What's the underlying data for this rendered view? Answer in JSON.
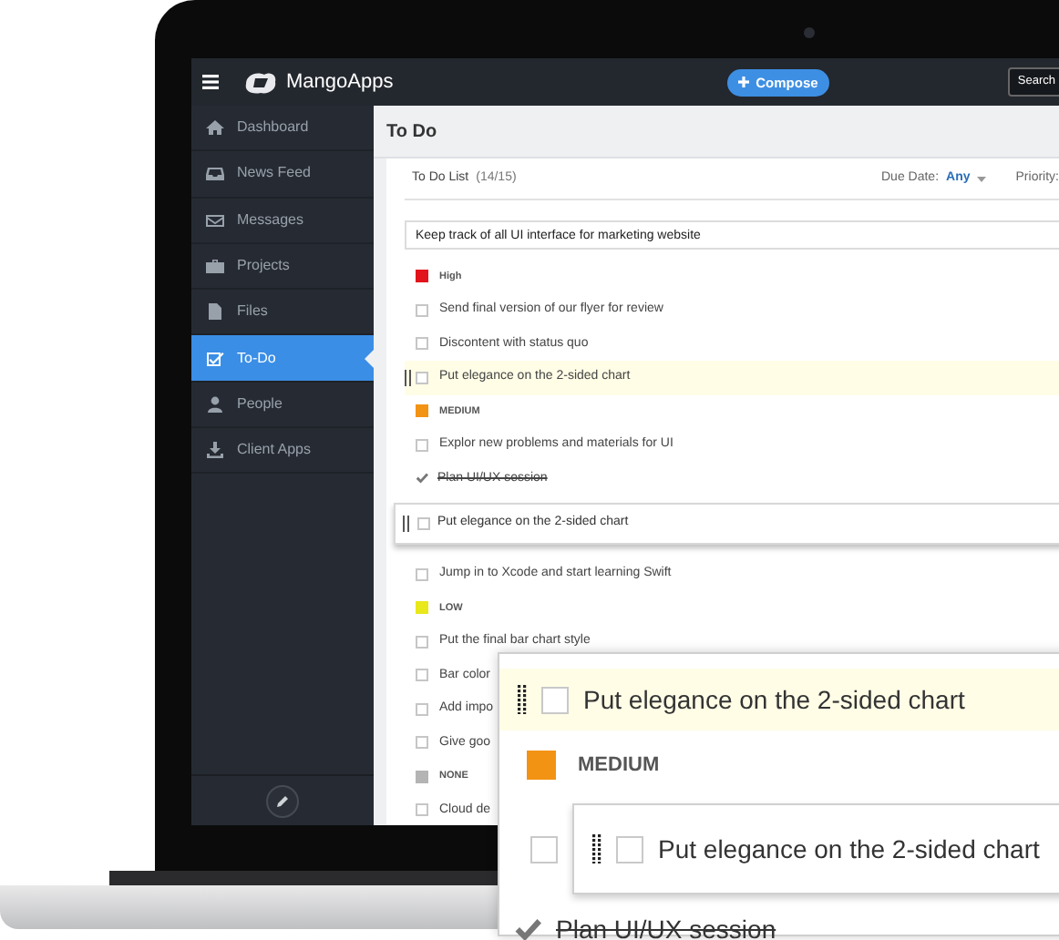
{
  "topbar": {
    "logo_text": "MangoApps",
    "compose_button": "Compose",
    "search_button": "Search"
  },
  "sidebar": {
    "items": [
      {
        "label": "Dashboard",
        "selected": false
      },
      {
        "label": "News Feed",
        "selected": false
      },
      {
        "label": "Messages",
        "selected": false
      },
      {
        "label": "Projects",
        "selected": false
      },
      {
        "label": "Files",
        "selected": false
      },
      {
        "label": "To-Do",
        "selected": true
      },
      {
        "label": "People",
        "selected": false
      },
      {
        "label": "Client Apps",
        "selected": false
      }
    ]
  },
  "page_title": "To Do",
  "list_header": {
    "title": "To Do List",
    "count": "(14/15)",
    "due_label": "Due Date:",
    "due_value": "Any",
    "priority_label": "Priority:"
  },
  "new_task": {
    "value": "Keep track of all UI interface for marketing website"
  },
  "tasks": [
    {
      "kind": "group",
      "label": "High",
      "color": "#e3131b"
    },
    {
      "kind": "task",
      "label": "Send final version of our flyer for review",
      "checked": false,
      "highlighted": false
    },
    {
      "kind": "task",
      "label": "Discontent with status quo",
      "checked": false,
      "highlighted": false
    },
    {
      "kind": "task",
      "label": "Put elegance on the 2-sided chart",
      "checked": false,
      "highlighted": true
    },
    {
      "kind": "group",
      "label": "MEDIUM",
      "color": "#f39313"
    },
    {
      "kind": "task",
      "label": "Explor new problems and materials for UI",
      "checked": false,
      "highlighted": false
    },
    {
      "kind": "task",
      "label": "Plan UI/UX session",
      "checked": true,
      "highlighted": false
    },
    {
      "kind": "dragged",
      "label": "Put elegance on the 2-sided chart",
      "checked": false
    },
    {
      "kind": "task",
      "label": "Jump in to Xcode and start learning Swift",
      "checked": false,
      "highlighted": false
    },
    {
      "kind": "group",
      "label": "LOW",
      "color": "#e8e81a"
    },
    {
      "kind": "task",
      "label": "Put the final bar chart style",
      "checked": false,
      "highlighted": false
    },
    {
      "kind": "task",
      "label": "Bar color",
      "checked": false,
      "highlighted": false
    },
    {
      "kind": "task",
      "label": "Add impo",
      "checked": false,
      "highlighted": false
    },
    {
      "kind": "task",
      "label": "Give goo",
      "checked": false,
      "highlighted": false
    },
    {
      "kind": "group",
      "label": "NONE",
      "color": "#b4b4b4"
    },
    {
      "kind": "task",
      "label": "Cloud de",
      "checked": false,
      "highlighted": false
    }
  ],
  "callout": {
    "items": [
      {
        "kind": "task",
        "label": "Put elegance on the 2-sided chart",
        "checked": false,
        "highlighted": true
      },
      {
        "kind": "group",
        "label": "MEDIUM",
        "color": "#f39313"
      },
      {
        "kind": "drop",
        "label": "Put elegance on the 2-sided chart",
        "checked": false,
        "row_checked": false
      },
      {
        "kind": "task",
        "label": "Plan UI/UX session",
        "checked": true,
        "highlighted": false
      }
    ]
  }
}
